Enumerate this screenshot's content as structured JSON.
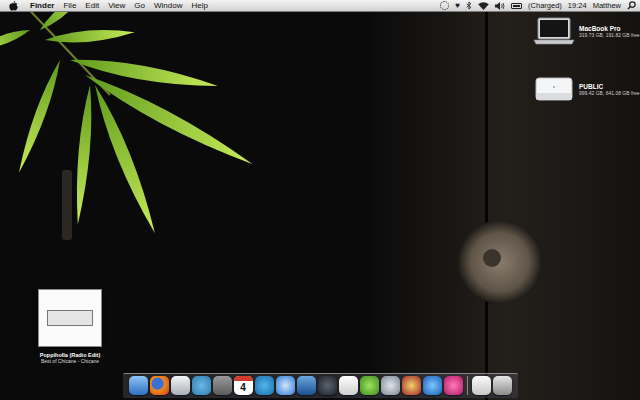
{
  "menu_bar": {
    "app_menu": "Finder",
    "menus": [
      "File",
      "Edit",
      "View",
      "Go",
      "Window",
      "Help"
    ],
    "battery": "(Charged)",
    "clock": "19:24",
    "user": "Matthew"
  },
  "desktop_icons": [
    {
      "name": "MacBook Pro",
      "info": "319.73 GB, 191.82 GB free",
      "kind": "laptop"
    },
    {
      "name": "PUBLIC",
      "info": "999.42 GB, 641.08 GB free",
      "kind": "drive"
    }
  ],
  "now_playing": {
    "title": "Poppiholla (Radio Edit)",
    "album_artist": "Best of Chicane - Chicane"
  },
  "dock": {
    "calendar_day": "4"
  }
}
